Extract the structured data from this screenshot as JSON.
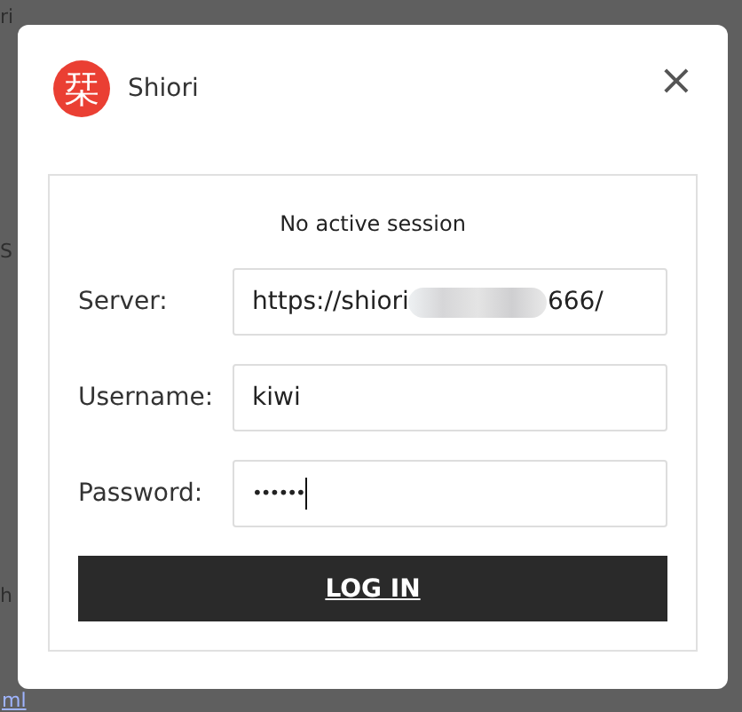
{
  "background": {
    "texts": [
      {
        "text": "ri",
        "kind": "plain"
      },
      {
        "text": "S",
        "kind": "plain"
      },
      {
        "text": "h",
        "kind": "plain"
      },
      {
        "text": "ml",
        "kind": "link"
      }
    ]
  },
  "dialog": {
    "logo": "栞",
    "title": "Shiori",
    "close": "×"
  },
  "status": "No active session",
  "fields": [
    {
      "label": "Server:",
      "value": "https://shiori",
      "value_end": "666/",
      "redacted": true,
      "focused": false,
      "masked": false
    },
    {
      "label": "Username:",
      "value": "kiwi",
      "redacted": false,
      "focused": false,
      "masked": false
    },
    {
      "label": "Password:",
      "value": "••••••",
      "redacted": false,
      "focused": true,
      "masked": true
    }
  ],
  "button": "LOG IN"
}
